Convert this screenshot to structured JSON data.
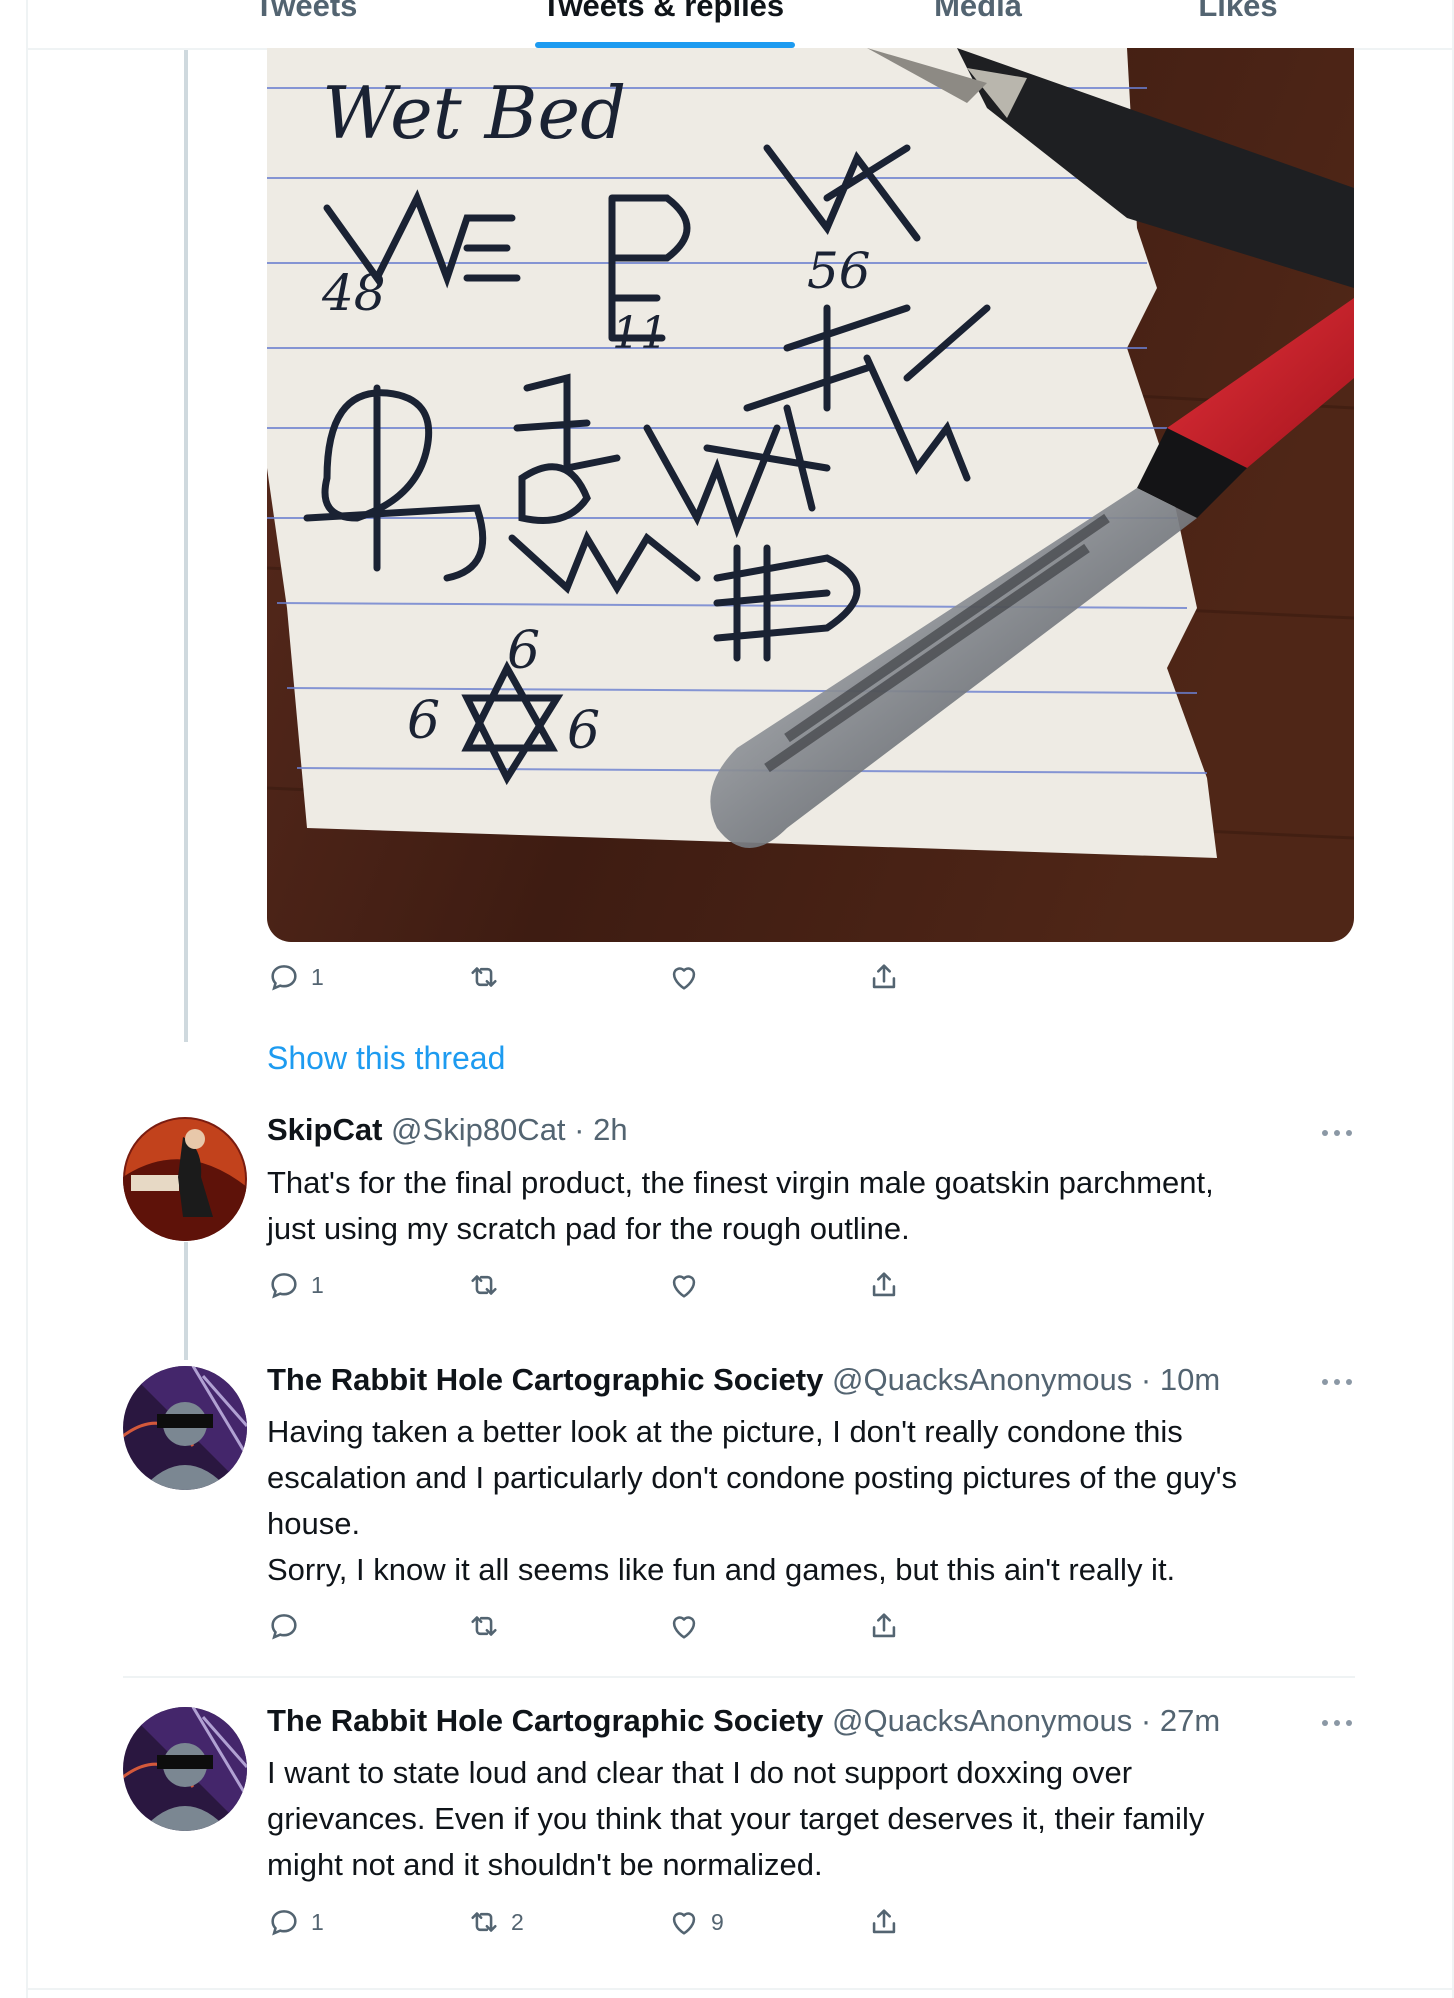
{
  "tabs": [
    {
      "label": "Tweets"
    },
    {
      "label": "Tweets & replies"
    },
    {
      "label": "Media"
    },
    {
      "label": "Likes"
    }
  ],
  "active_tab": "Tweets & replies",
  "photo_tweet": {
    "image_description": "handwritten sigils on lined paper with two fountain pens",
    "photo_text": [
      "Wet Bed",
      "48",
      "11",
      "56",
      "6",
      "6",
      "6"
    ],
    "actions": {
      "reply_count": "1",
      "retweet_count": "",
      "like_count": ""
    },
    "show_thread_label": "Show this thread"
  },
  "replies": [
    {
      "name": "SkipCat",
      "handle": "@Skip80Cat",
      "time": "· 2h",
      "text_lines": [
        "That's for the final product, the finest virgin male goatskin parchment,",
        "just using my scratch pad for the rough outline."
      ],
      "reply_count": "1",
      "retweet_count": "",
      "like_count": ""
    },
    {
      "name": "The Rabbit Hole Cartographic Society",
      "handle": "@QuacksAnonymous",
      "time": "· 10m",
      "text_lines": [
        "Having taken a better look at the picture, I don't really condone this",
        "escalation and I particularly don't condone posting pictures of the guy's",
        "house.",
        "Sorry, I know it all seems like fun and games, but this ain't really it."
      ],
      "reply_count": "",
      "retweet_count": "",
      "like_count": ""
    },
    {
      "name": "The Rabbit Hole Cartographic Society",
      "handle": "@QuacksAnonymous",
      "time": "· 27m",
      "text_lines": [
        "I want to state loud and clear that I do not support doxxing over",
        "grievances. Even if you think that your target deserves it, their family",
        "might not and it shouldn't be normalized."
      ],
      "reply_count": "1",
      "retweet_count": "2",
      "like_count": "9"
    }
  ],
  "colors": {
    "accent": "#1d9bf0",
    "text_primary": "#0f1419",
    "text_secondary": "#536471",
    "border": "#eff3f4",
    "thread_line": "#cfd9de"
  },
  "icons": [
    "reply-icon",
    "retweet-icon",
    "like-icon",
    "share-icon",
    "more-icon"
  ]
}
